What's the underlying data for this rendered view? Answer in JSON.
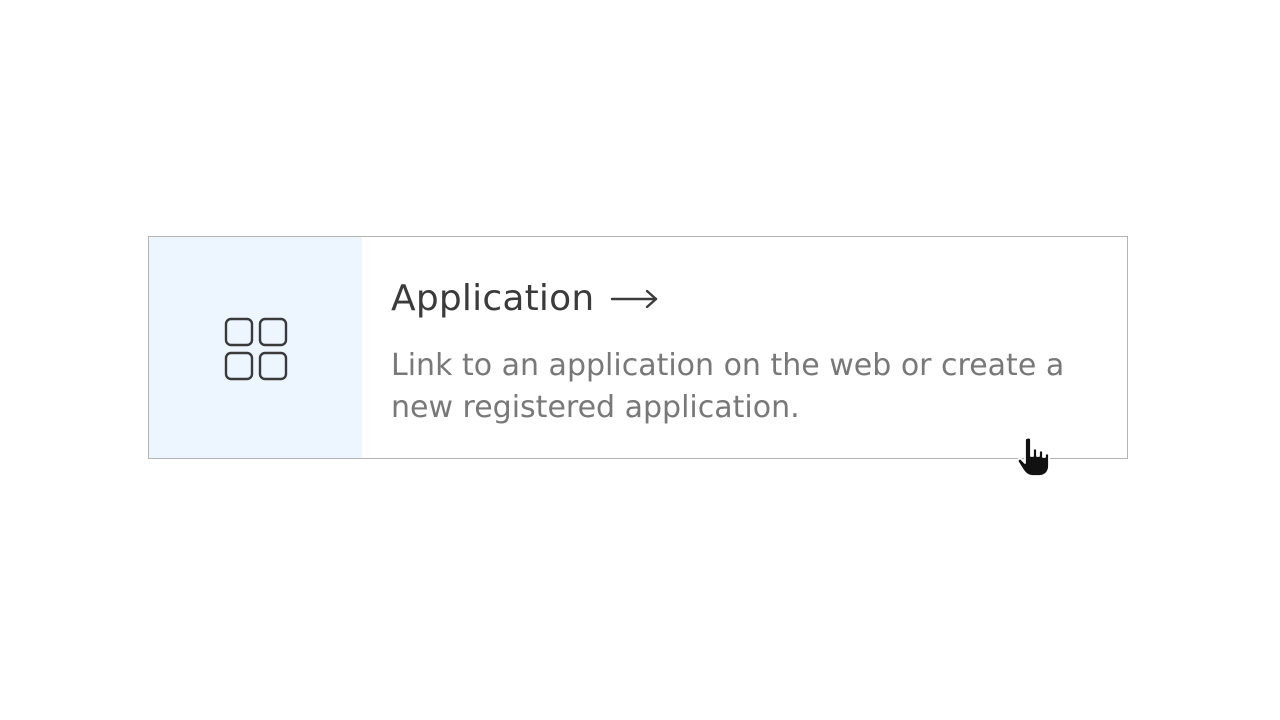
{
  "card": {
    "title": "Application",
    "arrow_icon": "arrow-right-icon",
    "media_icon": "apps-grid-icon",
    "description": "Link to an application on the web or create a new registered application.",
    "colors": {
      "media_bg": "#edf5ff",
      "border": "#b4b4b4",
      "title": "#3b3b3b",
      "description": "#787878"
    }
  },
  "pointer": {
    "icon": "hand-pointer-icon"
  }
}
